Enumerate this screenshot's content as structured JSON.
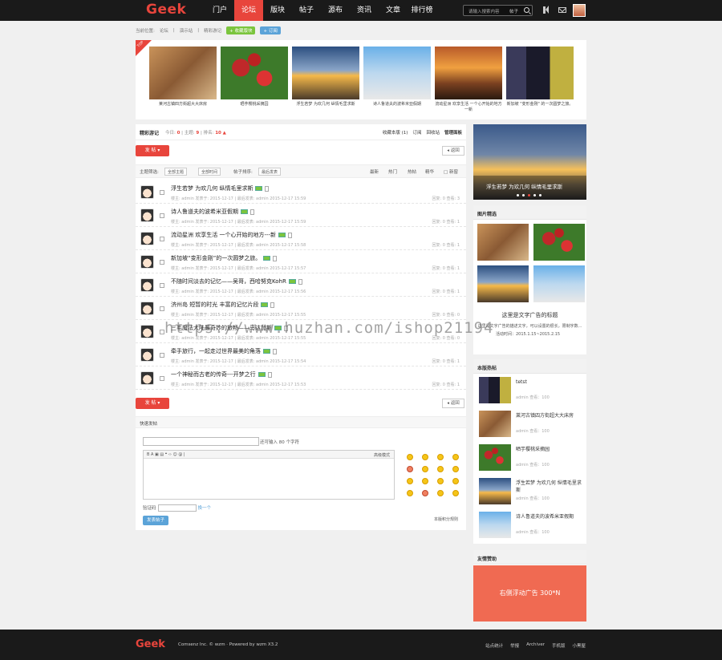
{
  "header": {
    "logo": "Geek",
    "nav": [
      "门户",
      "论坛",
      "版块",
      "帖子",
      "源布",
      "资讯",
      "文章",
      "排行榜"
    ],
    "active": "论坛",
    "search_placeholder": "请输入搜索内容",
    "search_type": "帖子"
  },
  "breadcrumb": {
    "label": "当前位置:",
    "items": [
      "论坛",
      "演示站",
      "精彩游记"
    ],
    "fav_btn": "+ 收藏版块",
    "sub_btn": "+ 订阅"
  },
  "slider": {
    "flag": "TOP",
    "items": [
      "莱河古镇四方街超大大床房",
      "晒芋樱桃采摘园",
      "浮生若梦 为欢几何 纵情毛里求斯",
      "诗人鲁道夫的波希米亚假期",
      "流动星洲 欢享生活 一个心开始的地方一新",
      "新加坡 \"变形金刚\" 的一次圆梦之旅。"
    ]
  },
  "forum": {
    "name": "精彩游记",
    "today_label": "今日:",
    "today": "0",
    "topics_label": "主题:",
    "topics": "9",
    "rank_label": "排名:",
    "rank": "10",
    "fav": "收藏本版 (1)",
    "sub": "订阅",
    "recycle": "回收站",
    "admin": "管理面板",
    "post_btn": "发 帖",
    "back_btn": "返回"
  },
  "filter": {
    "theme_label": "主题筛选:",
    "theme": "全部主题",
    "time": "全部时间",
    "sort_label": "帖子排序:",
    "sort": "最后发表",
    "tabs": [
      "最新",
      "热门",
      "热帖",
      "精华",
      "新窗"
    ]
  },
  "threads": [
    {
      "title": "浮生若梦 为欢几何 纵情毛里求斯",
      "meta": "楼主: admin 发表于: 2015-12-17 | 最后发表: admin 2015-12-17 15:59",
      "stat": "回复: 0  查看: 3"
    },
    {
      "title": "诗人鲁道夫的波希米亚假期",
      "meta": "楼主: admin 发表于: 2015-12-17 | 最后发表: admin 2015-12-17 15:59",
      "stat": "回复: 0  查看: 1"
    },
    {
      "title": "流动星洲 欢享生活 一个心开始的地方---新",
      "meta": "楼主: admin 发表于: 2015-12-17 | 最后发表: admin 2015-12-17 15:58",
      "stat": "回复: 0  查看: 1"
    },
    {
      "title": "新加坡“变形金刚”的一次圆梦之旅。",
      "meta": "楼主: admin 发表于: 2015-12-17 | 最后发表: admin 2015-12-17 15:57",
      "stat": "回复: 0  查看: 1"
    },
    {
      "title": "不随时间淡去的记忆——吴哥，西哈努克KohR",
      "meta": "楼主: admin 发表于: 2015-12-17 | 最后发表: admin 2015-12-17 15:56",
      "stat": "回复: 0  查看: 1"
    },
    {
      "title": "济州岛 短暂的时光 丰富的记忆片段",
      "meta": "楼主: admin 发表于: 2015-12-17 | 最后发表: admin 2015-12-17 15:55",
      "stat": "回复: 0  查看: 0"
    },
    {
      "title": "三毛魔法大陆最奇妙的旅畅——马达加斯",
      "meta": "楼主: admin 发表于: 2015-12-17 | 最后发表: admin 2015-12-17 15:55",
      "stat": "回复: 0  查看: 0"
    },
    {
      "title": "牵手旅行，一起走过世界最美的角落",
      "meta": "楼主: admin 发表于: 2015-12-17 | 最后发表: admin 2015-12-17 15:54",
      "stat": "回复: 0  查看: 1"
    },
    {
      "title": "一个神秘而古老的传奇---开梦之行",
      "meta": "楼主: admin 发表于: 2015-12-17 | 最后发表: admin 2015-12-17 15:53",
      "stat": "回复: 0  查看: 1"
    }
  ],
  "quick": {
    "title": "快速发帖",
    "hint": "还可输入 80 个字符",
    "advanced": "高级模式",
    "toolbar": "B  A  ▣  ▤  ❝  ‹›  ☺  @  |",
    "captcha_label": "验证码",
    "captcha_change": "换一个",
    "submit": "发表帖子",
    "rule": "本版积分规则"
  },
  "side": {
    "banner_caption": "浮生若梦 为欢几何 纵情毛里求斯",
    "pic_title": "图片精选",
    "ad_title": "这里是文字广告的标题",
    "ad_sub": "这里是文字广告的描述文字，可以设置的很长，限制字数...",
    "ad_date": "活动时间：2015.1.15~2015.2.15",
    "hot_title": "本版热帖",
    "hot": [
      {
        "title": "tetst",
        "meta": "admin   查看：100"
      },
      {
        "title": "莱河古镇四方街超大大床房",
        "meta": "admin   查看：100"
      },
      {
        "title": "晒芋樱桃采摘园",
        "meta": "admin   查看：100"
      },
      {
        "title": "浮生若梦 为欢几何 纵情毛里求斯",
        "meta": "admin   查看：100"
      },
      {
        "title": "诗人鲁道夫的波希米亚假期",
        "meta": "admin   查看：100"
      }
    ],
    "friend_title": "友情赞助",
    "ad_box": "右侧浮动广告 300*N"
  },
  "footer": {
    "logo": "Geek",
    "copy": "Comsenz Inc. © wzm · Powered by wzm X3.2",
    "links": [
      "站点统计",
      "举报",
      "Archiver",
      "手机版",
      "小黑屋"
    ]
  },
  "watermark": "https://www.huzhan.com/ishop21194"
}
